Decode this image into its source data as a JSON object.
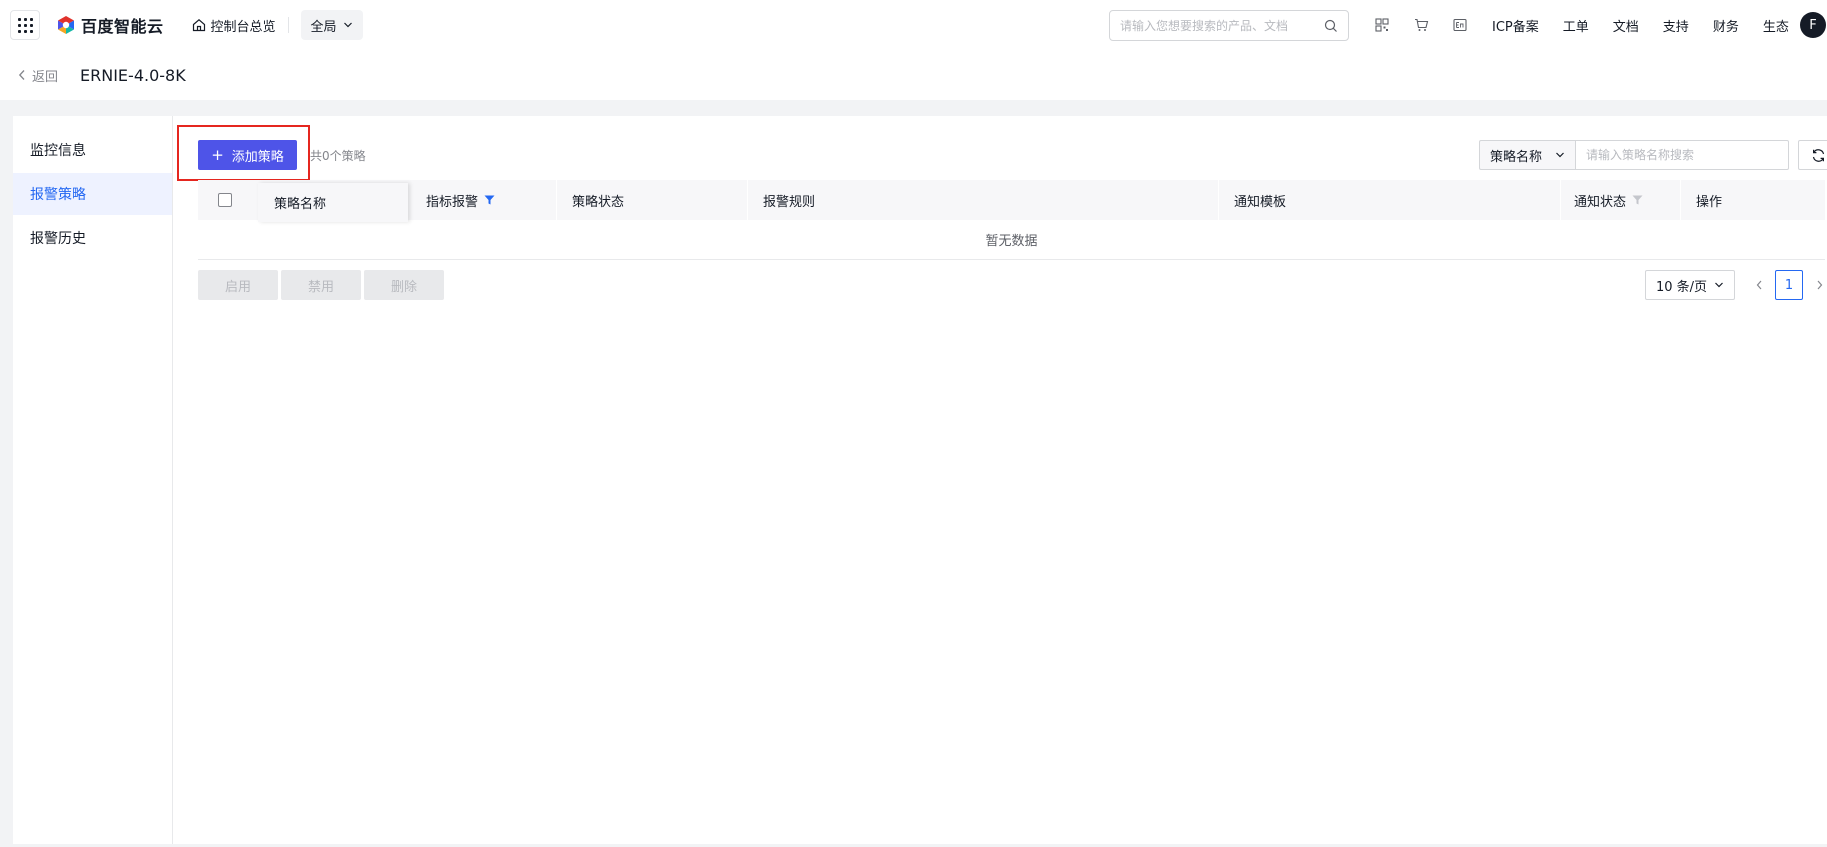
{
  "topbar": {
    "brand": "百度智能云",
    "home_label": "控制台总览",
    "region_label": "全局",
    "search_placeholder": "请输入您想要搜索的产品、文档",
    "links": [
      "ICP备案",
      "工单",
      "文档",
      "支持",
      "财务",
      "生态"
    ],
    "avatar_letter": "F",
    "icons": [
      "qrcode-icon",
      "cart-icon",
      "language-icon"
    ]
  },
  "subheader": {
    "back_label": "返回",
    "title": "ERNIE-4.0-8K"
  },
  "sidemenu": {
    "items": [
      {
        "label": "监控信息",
        "active": false
      },
      {
        "label": "报警策略",
        "active": true
      },
      {
        "label": "报警历史",
        "active": false
      }
    ]
  },
  "toolbar": {
    "add_label": "添加策略",
    "count_text": "共0个策略",
    "search_field": "策略名称",
    "search_placeholder": "请输入策略名称搜索"
  },
  "table": {
    "columns": [
      "策略名称",
      "指标报警",
      "策略状态",
      "报警规则",
      "通知模板",
      "通知状态",
      "操作"
    ],
    "empty_text": "暂无数据"
  },
  "batch": {
    "enable_label": "启用",
    "disable_label": "禁用",
    "delete_label": "删除"
  },
  "pager": {
    "page_size_label": "10 条/页",
    "current_page": "1"
  },
  "colors": {
    "primary": "#4e54e8",
    "active_text": "#2468f2",
    "highlight": "#e5261f"
  }
}
